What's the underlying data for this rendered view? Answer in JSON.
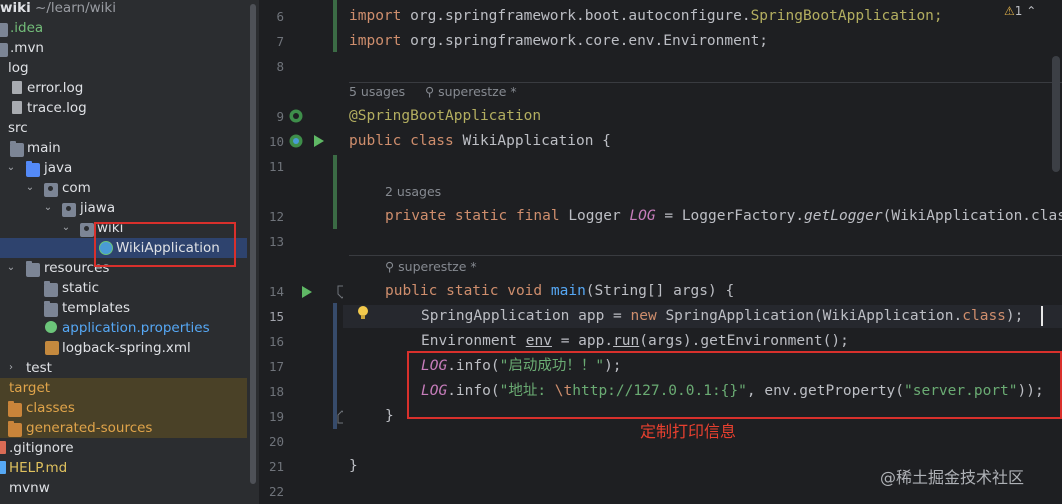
{
  "project": {
    "root_name": "wiki",
    "root_path": "~/learn/wiki",
    "items": [
      {
        "label": "wiki",
        "extra": "~/learn/wiki"
      },
      {
        "label": ".idea"
      },
      {
        "label": ".mvn"
      },
      {
        "label": "log"
      },
      {
        "label": "error.log"
      },
      {
        "label": "trace.log"
      },
      {
        "label": "src"
      },
      {
        "label": "main"
      },
      {
        "label": "java"
      },
      {
        "label": "com"
      },
      {
        "label": "jiawa"
      },
      {
        "label": "wiki"
      },
      {
        "label": "WikiApplication"
      },
      {
        "label": "resources"
      },
      {
        "label": "static"
      },
      {
        "label": "templates"
      },
      {
        "label": "application.properties"
      },
      {
        "label": "logback-spring.xml"
      },
      {
        "label": "test"
      },
      {
        "label": "target"
      },
      {
        "label": "classes"
      },
      {
        "label": "generated-sources"
      },
      {
        "label": ".gitignore"
      },
      {
        "label": "HELP.md"
      },
      {
        "label": "mvnw"
      }
    ]
  },
  "editor": {
    "warning_count": "1",
    "line_numbers": [
      "6",
      "7",
      "8",
      "9",
      "10",
      "11",
      "12",
      "13",
      "14",
      "15",
      "16",
      "17",
      "18",
      "19",
      "20",
      "21",
      "22"
    ],
    "hints": {
      "usages5": "5 usages",
      "author1": "superestze *",
      "usages2": "2 usages",
      "author2": "superestze *"
    },
    "code": {
      "l6_kw": "import ",
      "l6_a": "org.springframework.boot.autoconfigure.",
      "l6_b": "SpringBootApplication",
      "l6_c": ";",
      "l7_kw": "import ",
      "l7_a": "org.springframework.core.env.Environment;",
      "l9": "@SpringBootApplication",
      "l10_kw": "public class ",
      "l10_a": "WikiApplication {",
      "l12_kw": "private static final ",
      "l12_a": "Logger ",
      "l12_f": "LOG",
      "l12_b": " = LoggerFactory.",
      "l12_m": "getLogger",
      "l12_c": "(WikiApplication.class);",
      "l14_kw": "public static void ",
      "l14_m": "main",
      "l14_a": "(String[] args) {",
      "l15_a": "SpringApplication app = ",
      "l15_kw": "new ",
      "l15_b": "SpringApplication(WikiApplication.",
      "l15_kw2": "class",
      "l15_c": ");",
      "l16_a": "Environment ",
      "l16_v": "env",
      "l16_b": " = app.",
      "l16_m": "run",
      "l16_c": "(args).getEnvironment();",
      "l17_f": "LOG",
      "l17_a": ".info(",
      "l17_s": "\"启动成功！！\"",
      "l17_b": ");",
      "l18_f": "LOG",
      "l18_a": ".info(",
      "l18_s1": "\"地址: ",
      "l18_e": "\\t",
      "l18_s2": "http://127.0.0.1:{}\"",
      "l18_b": ", env.getProperty(",
      "l18_s3": "\"server.port\"",
      "l18_c": "));",
      "l19": "}",
      "l21": "}"
    }
  },
  "annotation_note": "定制打印信息",
  "watermark": "@稀土掘金技术社区",
  "colors": {
    "annotation_red": "#d9302c",
    "selection_blue": "#2e436e",
    "excluded_yellow": "#4a4127"
  }
}
